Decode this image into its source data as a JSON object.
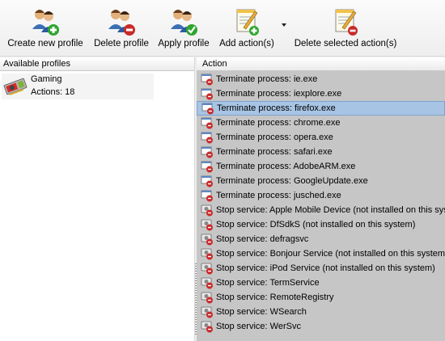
{
  "toolbar": {
    "buttons": [
      {
        "label": "Create new profile",
        "icon": "users-add-icon"
      },
      {
        "label": "Delete profile",
        "icon": "users-delete-icon"
      },
      {
        "label": "Apply profile",
        "icon": "users-apply-icon"
      },
      {
        "label": "Add action(s)",
        "icon": "notepad-add-icon"
      },
      {
        "label": "Delete selected action(s)",
        "icon": "notepad-delete-icon"
      }
    ]
  },
  "profiles_pane": {
    "header": "Available profiles",
    "items": [
      {
        "name": "Gaming",
        "actions": "Actions: 18",
        "icon": "graphics-card-icon"
      }
    ]
  },
  "actions_pane": {
    "header": "Action",
    "selected_index": 2,
    "rows": [
      {
        "text": "Terminate process: ie.exe",
        "icon": "process-gear-icon"
      },
      {
        "text": "Terminate process: iexplore.exe",
        "icon": "process-gear-icon"
      },
      {
        "text": "Terminate process: firefox.exe",
        "icon": "process-gear-icon"
      },
      {
        "text": "Terminate process: chrome.exe",
        "icon": "process-gear-icon"
      },
      {
        "text": "Terminate process: opera.exe",
        "icon": "process-gear-icon"
      },
      {
        "text": "Terminate process: safari.exe",
        "icon": "process-gear-icon"
      },
      {
        "text": "Terminate process: AdobeARM.exe",
        "icon": "process-gear-icon"
      },
      {
        "text": "Terminate process: GoogleUpdate.exe",
        "icon": "process-gear-icon"
      },
      {
        "text": "Terminate process: jusched.exe",
        "icon": "process-gear-icon"
      },
      {
        "text": "Stop service: Apple Mobile Device (not installed on this system)",
        "icon": "service-gear-icon"
      },
      {
        "text": "Stop service: DfSdkS (not installed on this system)",
        "icon": "service-gear-icon"
      },
      {
        "text": "Stop service: defragsvc",
        "icon": "service-gear-icon"
      },
      {
        "text": "Stop service: Bonjour Service (not installed on this system)",
        "icon": "service-gear-icon"
      },
      {
        "text": "Stop service: iPod Service (not installed on this system)",
        "icon": "service-gear-icon"
      },
      {
        "text": "Stop service: TermService",
        "icon": "service-gear-icon"
      },
      {
        "text": "Stop service: RemoteRegistry",
        "icon": "service-gear-icon"
      },
      {
        "text": "Stop service: WSearch",
        "icon": "service-gear-icon"
      },
      {
        "text": "Stop service: WerSvc",
        "icon": "service-gear-icon"
      }
    ]
  }
}
